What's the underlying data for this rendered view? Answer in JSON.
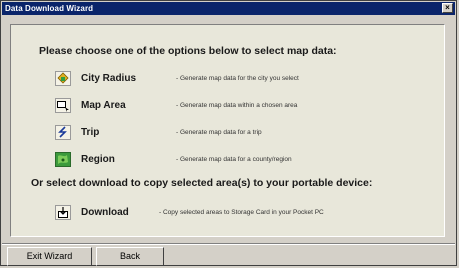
{
  "window": {
    "title": "Data Download Wizard",
    "close_glyph": "×"
  },
  "panel": {
    "heading_options": "Please choose one of the options below to select map data:",
    "heading_download": "Or select download to copy selected area(s) to your portable device:",
    "options": [
      {
        "label": "City Radius",
        "description": "- Generate map data for the city you select",
        "icon": "city-radius-icon"
      },
      {
        "label": "Map Area",
        "description": "- Generate map data within a chosen area",
        "icon": "map-area-icon"
      },
      {
        "label": "Trip",
        "description": "- Generate map data for a trip",
        "icon": "trip-icon"
      },
      {
        "label": "Region",
        "description": "- Generate map data for a  county/region",
        "icon": "region-icon"
      }
    ],
    "download": {
      "label": "Download",
      "description": "- Copy selected areas to Storage Card in your Pocket PC",
      "icon": "download-icon"
    }
  },
  "footer": {
    "exit_label": "Exit Wizard",
    "back_label": "Back"
  },
  "colors": {
    "titlebar": "#0a246a",
    "face": "#d4d0c8",
    "panel": "#e8e7da"
  }
}
